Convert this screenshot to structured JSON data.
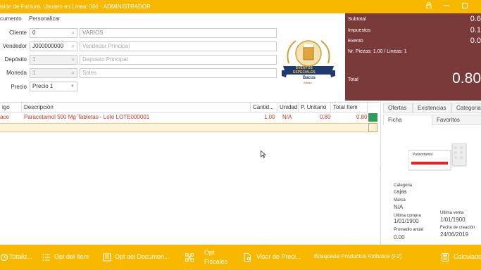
{
  "window": {
    "title": "isión de Factura. Usuario en Línea: 001 - ADMINISTRADOR",
    "controls": {
      "lock": "lock-icon",
      "minimize": "minimize-icon",
      "maximize": "maximize-icon"
    }
  },
  "tabs": [
    "cumento",
    "Personalizar"
  ],
  "form": {
    "cliente": {
      "label": "Cliente",
      "code": "0",
      "name": "VARIOS"
    },
    "vendedor": {
      "label": "Vendedor",
      "code": "J000000000",
      "name": "Vendedor Principal"
    },
    "deposito": {
      "label": "Depósito",
      "code": "1",
      "name": "Deposito Principal"
    },
    "moneda": {
      "label": "Moneda",
      "code": "1",
      "name": "Soles"
    },
    "precio": {
      "label": "Precio",
      "value": "Precio 1"
    }
  },
  "logo": {
    "line1": "EVENTOS",
    "line2": "ESPECIALES",
    "line3": "Bacus",
    "line4": "Atlidev"
  },
  "totals": {
    "subtotal_label": "Subtotal",
    "subtotal_value": "0.6",
    "impuestos_label": "Impuestos",
    "impuestos_value": "0.1",
    "exento_label": "Exento",
    "exento_value": "0.0",
    "piezas": "Nr. Piezas: 1.00 / Lineas: 1",
    "total_label": "Total",
    "total_value": "0.80"
  },
  "grid": {
    "headers": [
      "igo",
      "Descripción",
      "Cantid...",
      "Unidad",
      "P. Unitario",
      "Total Item"
    ],
    "rows": [
      {
        "code": "ace",
        "description": "Paracetamol 500 Mg Tabletas - Lote LOTE000001",
        "qty": "1.00",
        "unit": "N/A",
        "unit_price": "0.80",
        "total": "0.80"
      }
    ]
  },
  "right_panel": {
    "tabs_top": [
      "Ofertas",
      "Existencias",
      "Categoria"
    ],
    "tabs_sub": [
      "Ficha",
      "Favoritos"
    ],
    "product_box_text": "Paracetamol",
    "categoria_label": "Categoria",
    "categoria_value": "cajas",
    "marca_label": "Marca",
    "marca_value": "N/A",
    "ultima_compra_label": "Ultima compra",
    "ultima_compra_value": "1/01/1900",
    "ultima_venta_label": "Ultima venta",
    "ultima_venta_value": "1/01/1900",
    "promedio_label": "Promedio anual",
    "promedio_value": "0.00",
    "fecha_creacion_label": "Fecha de creación",
    "fecha_creacion_value": "24/06/2019"
  },
  "bottom_bar": {
    "totalizar": "Totaliz...",
    "opt_item": "Opt del Item",
    "opt_documento": "Opt del Documen...",
    "opt_fiscales_1": "Opt",
    "opt_fiscales_2": "Fiscales",
    "visor": "Visor de Preci...",
    "busqueda": "Búsqueda Productos Atributos (F2)",
    "calculadora": "Calculado"
  },
  "colors": {
    "accent": "#f9b800",
    "totals_bg": "#7b3a3a",
    "row_text": "#c0392b",
    "selected_row": "#fdf3d8",
    "green_marker": "#2e9d57"
  }
}
